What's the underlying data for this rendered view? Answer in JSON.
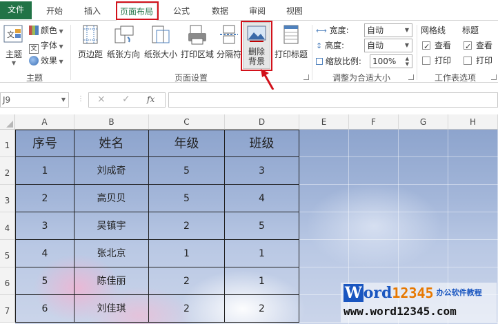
{
  "tabs": [
    {
      "label": "文件"
    },
    {
      "label": "开始"
    },
    {
      "label": "插入"
    },
    {
      "label": "页面布局"
    },
    {
      "label": "公式"
    },
    {
      "label": "数据"
    },
    {
      "label": "审阅"
    },
    {
      "label": "视图"
    }
  ],
  "ribbon": {
    "theme": {
      "theme_label": "主题",
      "colors_label": "颜色",
      "fonts_label": "字体",
      "effects_label": "效果",
      "group_label": "主题"
    },
    "page_setup": {
      "margins_label": "页边距",
      "orientation_label": "纸张方向",
      "size_label": "纸张大小",
      "print_area_label": "打印区域",
      "breaks_label": "分隔符",
      "delete_bg_line1": "删除",
      "delete_bg_line2": "背景",
      "print_titles_label": "打印标题",
      "group_label": "页面设置"
    },
    "scale": {
      "width_label": "宽度:",
      "width_value": "自动",
      "height_label": "高度:",
      "height_value": "自动",
      "scale_label": "缩放比例:",
      "scale_value": "100%",
      "group_label": "调整为合适大小"
    },
    "sheet_options": {
      "gridlines_label": "网格线",
      "headings_label": "标题",
      "view_label": "查看",
      "print_label": "打印",
      "gridlines_view": true,
      "gridlines_print": false,
      "headings_view": true,
      "headings_print": false,
      "group_label": "工作表选项"
    }
  },
  "formula_bar": {
    "name_box": "J9",
    "cancel_icon": "×",
    "enter_icon": "✓",
    "fx_label": "fx",
    "formula": ""
  },
  "columns": [
    "A",
    "B",
    "C",
    "D",
    "E",
    "F",
    "G",
    "H"
  ],
  "rows": [
    "1",
    "2",
    "3",
    "4",
    "5",
    "6",
    "7"
  ],
  "table": {
    "headers": [
      "序号",
      "姓名",
      "年级",
      "班级"
    ],
    "rows": [
      [
        "1",
        "刘成奇",
        "5",
        "3"
      ],
      [
        "2",
        "高贝贝",
        "5",
        "4"
      ],
      [
        "3",
        "吴镇宇",
        "2",
        "5"
      ],
      [
        "4",
        "张北京",
        "1",
        "1"
      ],
      [
        "5",
        "陈佳丽",
        "2",
        "1"
      ],
      [
        "6",
        "刘佳琪",
        "2",
        "2"
      ]
    ]
  },
  "watermark": {
    "w": "W",
    "word": "ord",
    "num": "12345",
    "cn": "办公软件教程",
    "url": "www.word12345.com"
  },
  "colors": {
    "accent_green": "#217346",
    "highlight_red": "#d2111a",
    "watermark_blue": "#1a56c0",
    "watermark_orange": "#e77800"
  }
}
